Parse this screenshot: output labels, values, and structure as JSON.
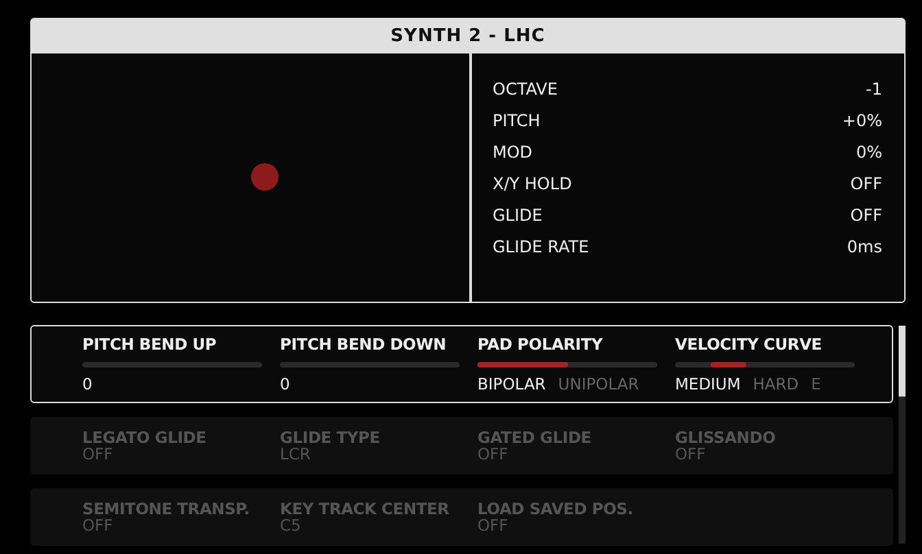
{
  "panel": {
    "title": "SYNTH 2 - LHC"
  },
  "info": [
    {
      "label": "OCTAVE",
      "value": "-1"
    },
    {
      "label": "PITCH",
      "value": "+0%"
    },
    {
      "label": "MOD",
      "value": "0%"
    },
    {
      "label": "X/Y HOLD",
      "value": "OFF"
    },
    {
      "label": "GLIDE",
      "value": "OFF"
    },
    {
      "label": "GLIDE RATE",
      "value": "0ms"
    }
  ],
  "param_rows": [
    {
      "selected": true,
      "disabled": false,
      "params": [
        {
          "kind": "slider",
          "label": "PITCH BEND UP",
          "value": "0"
        },
        {
          "kind": "slider",
          "label": "PITCH BEND DOWN",
          "value": "0"
        },
        {
          "kind": "switch",
          "label": "PAD POLARITY",
          "level": 0.5,
          "options": [
            {
              "label": "BIPOLAR",
              "selected": true
            },
            {
              "label": "UNIPOLAR",
              "selected": false
            }
          ]
        },
        {
          "kind": "stepped",
          "label": "VELOCITY CURVE",
          "options": [
            {
              "label": "MEDIUM",
              "selected": true
            },
            {
              "label": "HARD",
              "selected": false
            },
            {
              "label": "E",
              "selected": false
            }
          ]
        }
      ]
    },
    {
      "selected": false,
      "disabled": true,
      "params": [
        {
          "kind": "plain",
          "label": "LEGATO GLIDE",
          "value": "OFF"
        },
        {
          "kind": "plain",
          "label": "GLIDE TYPE",
          "value": "LCR"
        },
        {
          "kind": "plain",
          "label": "GATED GLIDE",
          "value": "OFF"
        },
        {
          "kind": "plain",
          "label": "GLISSANDO",
          "value": "OFF"
        }
      ]
    },
    {
      "selected": false,
      "disabled": true,
      "params": [
        {
          "kind": "plain",
          "label": "SEMITONE TRANSP.",
          "value": "OFF"
        },
        {
          "kind": "plain",
          "label": "KEY TRACK CENTER",
          "value": "C5"
        },
        {
          "kind": "plain",
          "label": "LOAD SAVED POS.",
          "value": "OFF"
        }
      ]
    }
  ]
}
